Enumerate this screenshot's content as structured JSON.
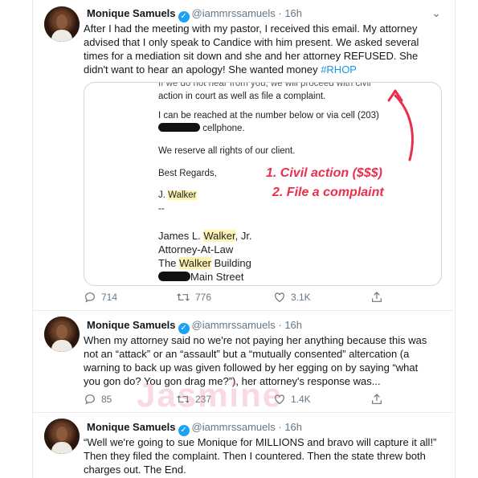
{
  "tweets": [
    {
      "name": "Monique Samuels",
      "handle": "@iammrssamuels",
      "time": "16h",
      "text": "After I had the meeting with my pastor, I received this email. My attorney advised that I only speak to Candice with him present. We asked several times for a mediation sit down and she and her attorney REFUSED. She didn't want to hear an apology! She wanted money ",
      "hashtag": "#RHOP",
      "replies": "714",
      "retweets": "776",
      "likes": "3.1K"
    },
    {
      "name": "Monique Samuels",
      "handle": "@iammrssamuels",
      "time": "16h",
      "text": "When my attorney said no we're not paying her anything because this was not an “attack” or an “assault” but a “mutually consented” altercation (a warning to back up was given followed by her egging on by saying “what you gon do? You gon drag me?”), her attorney's response was...",
      "replies": "85",
      "retweets": "237",
      "likes": "1.4K"
    },
    {
      "name": "Monique Samuels",
      "handle": "@iammrssamuels",
      "time": "16h",
      "text": "“Well we're going to sue Monique for MILLIONS and bravo will capture it all!” Then they filed the complaint. Then I countered. Then the state threw both charges out. The End."
    }
  ],
  "letter": {
    "cut_line": "If we do not hear from you, we will proceed with civil",
    "line1": "action in court as well as file a complaint.",
    "line2": "I can be reached at the number below or via cell (203)",
    "line3": "cellphone.",
    "line4": "We reserve all rights of our client.",
    "line5": "Best Regards,",
    "sig_initial": "J. ",
    "sig_name": "Walker",
    "dash": "--",
    "att_first": "James L. ",
    "att_name": "Walker",
    "att_suffix": ", Jr.",
    "att_title": "Attorney-At-Law",
    "bldg_pre": "The ",
    "bldg_name": "Walker",
    "bldg_post": " Building",
    "street": "Main Street"
  },
  "annotations": {
    "a1": "1. Civil action ($$$)",
    "a2": "2. File a complaint"
  },
  "watermark": "Jasmine"
}
